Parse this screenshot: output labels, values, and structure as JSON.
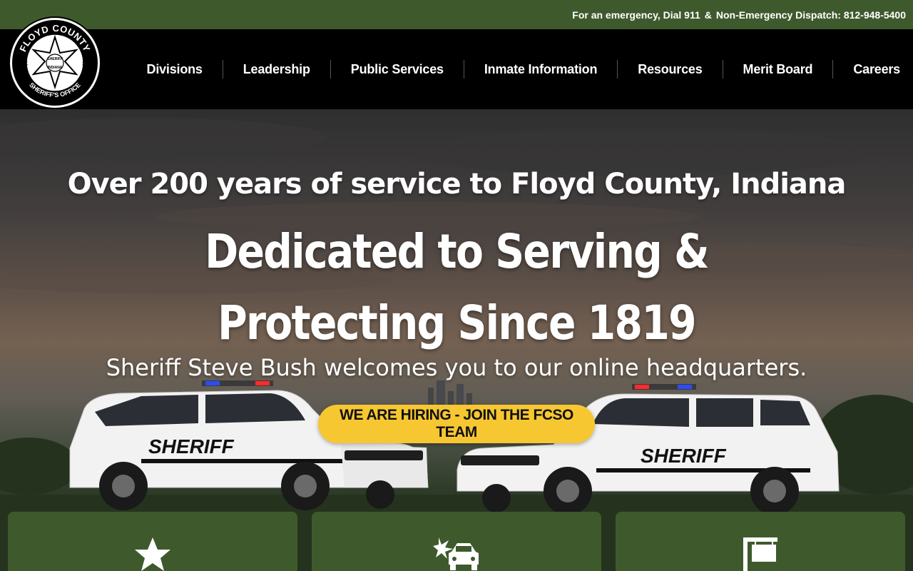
{
  "topbar": {
    "emergency_text": "For an emergency, Dial 911",
    "separator": "&",
    "dispatch_text": "Non-Emergency Dispatch: 812-948-5400"
  },
  "logo": {
    "top_text": "FLOYD COUNTY",
    "bottom_text": "SHERIFF'S OFFICE",
    "est_label": "EST.",
    "est_year": "1819",
    "star_text_1": "SHERIFF",
    "star_text_2": "INDIANA"
  },
  "nav": {
    "items": [
      {
        "label": "Divisions"
      },
      {
        "label": "Leadership"
      },
      {
        "label": "Public Services"
      },
      {
        "label": "Inmate Information"
      },
      {
        "label": "Resources"
      },
      {
        "label": "Merit Board"
      },
      {
        "label": "Careers"
      }
    ]
  },
  "hero": {
    "subtitle": "Over 200 years of service to Floyd County, Indiana",
    "title": "Dedicated to Serving & Protecting Since 1819",
    "welcome": "Sheriff Steve Bush welcomes you to our online headquarters.",
    "cta_label": "WE ARE HIRING - JOIN THE FCSO TEAM",
    "vehicle_text": "SHERIFF"
  },
  "cards": [
    {
      "icon": "star-icon"
    },
    {
      "icon": "car-crash-icon"
    },
    {
      "icon": "sign-icon"
    }
  ],
  "colors": {
    "brand_green": "#3e5a2d",
    "cta_yellow": "#f7c732",
    "nav_black": "#000000"
  }
}
